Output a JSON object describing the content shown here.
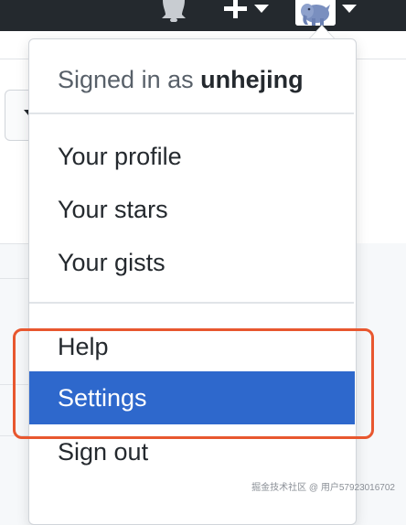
{
  "header": {
    "notifications_icon": "bell-icon",
    "create_icon": "plus-icon",
    "avatar_icon": "avatar-elephant-icon",
    "colors": {
      "background": "#24292e"
    }
  },
  "menu": {
    "signed_in_prefix": "Signed in as",
    "username": "unhejing",
    "items": [
      {
        "label": "Your profile"
      },
      {
        "label": "Your stars"
      },
      {
        "label": "Your gists"
      },
      {
        "label": "Help"
      },
      {
        "label": "Settings",
        "active": true
      },
      {
        "label": "Sign out"
      }
    ],
    "colors": {
      "active_bg": "#2e68cc",
      "active_text": "#ffffff",
      "text": "#24292e"
    }
  },
  "annotation": {
    "color": "#e8572f"
  },
  "watermark": {
    "text": "掘金技术社区 @ 用户57923016702"
  }
}
